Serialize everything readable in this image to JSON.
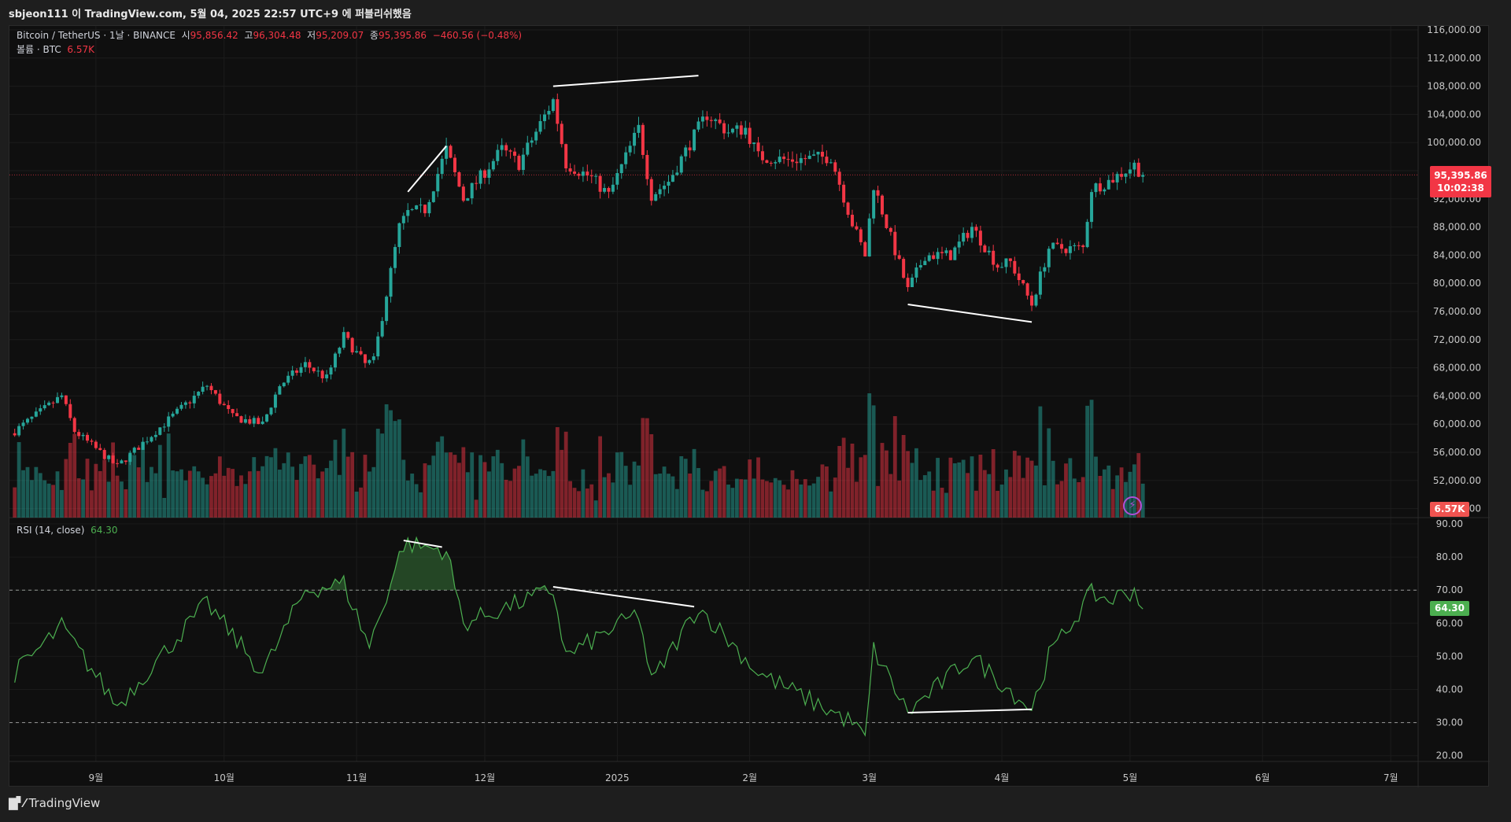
{
  "header": {
    "publish_line": "sbjeon111 이 TradingView.com, 5월 04, 2025 22:57 UTC+9 에 퍼블리쉬했음"
  },
  "legend": {
    "symbol": "Bitcoin / TetherUS · 1날 · BINANCE",
    "open_label": "시",
    "open": "95,856.42",
    "high_label": "고",
    "high": "96,304.48",
    "low_label": "저",
    "low": "95,209.07",
    "close_label": "종",
    "close": "95,395.86",
    "change": "−460.56 (−0.48%)",
    "volume_label": "볼륨 · BTC",
    "volume": "6.57K",
    "rsi_label": "RSI (14, close)",
    "rsi_value": "64.30"
  },
  "price_tag": {
    "price": "95,395.86",
    "countdown": "10:02:38"
  },
  "volume_tag": "6.57K",
  "rsi_tag": "64.30",
  "footer": {
    "brand": "TradingView"
  },
  "colors": {
    "up": "#26a69a",
    "down": "#f23645",
    "rsi": "#4caf50",
    "bg": "#0f0f0f"
  },
  "chart_data": {
    "type": "candlestick",
    "start_date": "2024-08-13",
    "end_date": "2025-05-04",
    "last_price": 95395.86,
    "price_ticks": [
      116000,
      112000,
      108000,
      104000,
      100000,
      96000,
      92000,
      88000,
      84000,
      80000,
      76000,
      72000,
      68000,
      64000,
      60000,
      56000,
      52000,
      48000
    ],
    "price_tick_labels": [
      "116,000.00",
      "112,000.00",
      "108,000.00",
      "104,000.00",
      "100,000.00",
      "96,000.00",
      "92,000.00",
      "88,000.00",
      "84,000.00",
      "80,000.00",
      "76,000.00",
      "72,000.00",
      "68,000.00",
      "64,000.00",
      "60,000.00",
      "56,000.00",
      "52,000.00",
      "48,000.00"
    ],
    "rsi_ticks": [
      90,
      80,
      70,
      60,
      50,
      40,
      30,
      20
    ],
    "rsi_tick_labels": [
      "90.00",
      "80.00",
      "70.00",
      "60.00",
      "50.00",
      "40.00",
      "30.00",
      "20.00"
    ],
    "rsi_bands": [
      70,
      30
    ],
    "x_ticks": [
      {
        "date": "2024-09-01",
        "label": "9월"
      },
      {
        "date": "2024-10-01",
        "label": "10월"
      },
      {
        "date": "2024-11-01",
        "label": "11월"
      },
      {
        "date": "2024-12-01",
        "label": "12월"
      },
      {
        "date": "2025-01-01",
        "label": "2025"
      },
      {
        "date": "2025-02-01",
        "label": "2월"
      },
      {
        "date": "2025-03-01",
        "label": "3월"
      },
      {
        "date": "2025-04-01",
        "label": "4월"
      },
      {
        "date": "2025-05-01",
        "label": "5월"
      },
      {
        "date": "2025-06-01",
        "label": "6월"
      },
      {
        "date": "2025-07-01",
        "label": "7월"
      }
    ],
    "close_anchors": [
      [
        "2024-08-13",
        59000
      ],
      [
        "2024-08-24",
        64000
      ],
      [
        "2024-08-27",
        59000
      ],
      [
        "2024-09-06",
        54000
      ],
      [
        "2024-09-15",
        59000
      ],
      [
        "2024-09-27",
        65500
      ],
      [
        "2024-10-03",
        61000
      ],
      [
        "2024-10-10",
        60000
      ],
      [
        "2024-10-14",
        65500
      ],
      [
        "2024-10-20",
        68500
      ],
      [
        "2024-10-25",
        66500
      ],
      [
        "2024-10-29",
        72500
      ],
      [
        "2024-11-03",
        68500
      ],
      [
        "2024-11-05",
        69000
      ],
      [
        "2024-11-11",
        88000
      ],
      [
        "2024-11-13",
        90000
      ],
      [
        "2024-11-17",
        90500
      ],
      [
        "2024-11-22",
        99000
      ],
      [
        "2024-11-26",
        92000
      ],
      [
        "2024-12-05",
        99000
      ],
      [
        "2024-12-09",
        97000
      ],
      [
        "2024-12-17",
        106000
      ],
      [
        "2024-12-20",
        97000
      ],
      [
        "2024-12-26",
        95000
      ],
      [
        "2024-12-30",
        92500
      ],
      [
        "2025-01-06",
        102000
      ],
      [
        "2025-01-09",
        92500
      ],
      [
        "2025-01-13",
        94500
      ],
      [
        "2025-01-20",
        102000
      ],
      [
        "2025-01-22",
        104000
      ],
      [
        "2025-01-27",
        101500
      ],
      [
        "2025-01-31",
        102000
      ],
      [
        "2025-02-03",
        98000
      ],
      [
        "2025-02-10",
        97500
      ],
      [
        "2025-02-20",
        98000
      ],
      [
        "2025-02-25",
        88500
      ],
      [
        "2025-02-28",
        84000
      ],
      [
        "2025-03-02",
        94000
      ],
      [
        "2025-03-10",
        79000
      ],
      [
        "2025-03-14",
        84000
      ],
      [
        "2025-03-20",
        84000
      ],
      [
        "2025-03-25",
        88000
      ],
      [
        "2025-03-31",
        82500
      ],
      [
        "2025-04-03",
        83000
      ],
      [
        "2025-04-08",
        77000
      ],
      [
        "2025-04-12",
        85000
      ],
      [
        "2025-04-20",
        85000
      ],
      [
        "2025-04-22",
        93500
      ],
      [
        "2025-04-26",
        94500
      ],
      [
        "2025-05-02",
        96800
      ],
      [
        "2025-05-04",
        95395.86
      ]
    ],
    "rsi_anchors": [
      [
        "2024-08-13",
        45
      ],
      [
        "2024-08-24",
        59
      ],
      [
        "2024-09-06",
        35
      ],
      [
        "2024-09-27",
        66
      ],
      [
        "2024-10-10",
        45
      ],
      [
        "2024-10-20",
        70
      ],
      [
        "2024-10-29",
        72
      ],
      [
        "2024-11-04",
        53
      ],
      [
        "2024-11-12",
        84
      ],
      [
        "2024-11-22",
        82
      ],
      [
        "2024-11-26",
        60
      ],
      [
        "2024-12-17",
        70
      ],
      [
        "2024-12-20",
        50
      ],
      [
        "2025-01-06",
        63
      ],
      [
        "2025-01-09",
        42
      ],
      [
        "2025-01-20",
        65
      ],
      [
        "2025-01-27",
        55
      ],
      [
        "2025-02-03",
        45
      ],
      [
        "2025-02-25",
        30
      ],
      [
        "2025-02-28",
        25
      ],
      [
        "2025-03-02",
        52
      ],
      [
        "2025-03-10",
        33
      ],
      [
        "2025-03-25",
        50
      ],
      [
        "2025-04-08",
        34
      ],
      [
        "2025-04-12",
        50
      ],
      [
        "2025-04-22",
        69
      ],
      [
        "2025-04-26",
        67
      ],
      [
        "2025-05-02",
        70
      ],
      [
        "2025-05-04",
        64.3
      ]
    ],
    "price_trendlines": [
      [
        [
          "2024-11-13",
          93000
        ],
        [
          "2024-11-22",
          99500
        ]
      ],
      [
        [
          "2024-12-17",
          108000
        ],
        [
          "2025-01-20",
          109500
        ]
      ],
      [
        [
          "2025-03-10",
          77000
        ],
        [
          "2025-04-08",
          74500
        ]
      ]
    ],
    "rsi_trendlines": [
      [
        [
          "2024-11-12",
          85
        ],
        [
          "2024-11-21",
          83
        ]
      ],
      [
        [
          "2024-12-17",
          71
        ],
        [
          "2025-01-19",
          65
        ]
      ],
      [
        [
          "2025-03-10",
          33
        ],
        [
          "2025-04-08",
          34
        ]
      ]
    ]
  }
}
